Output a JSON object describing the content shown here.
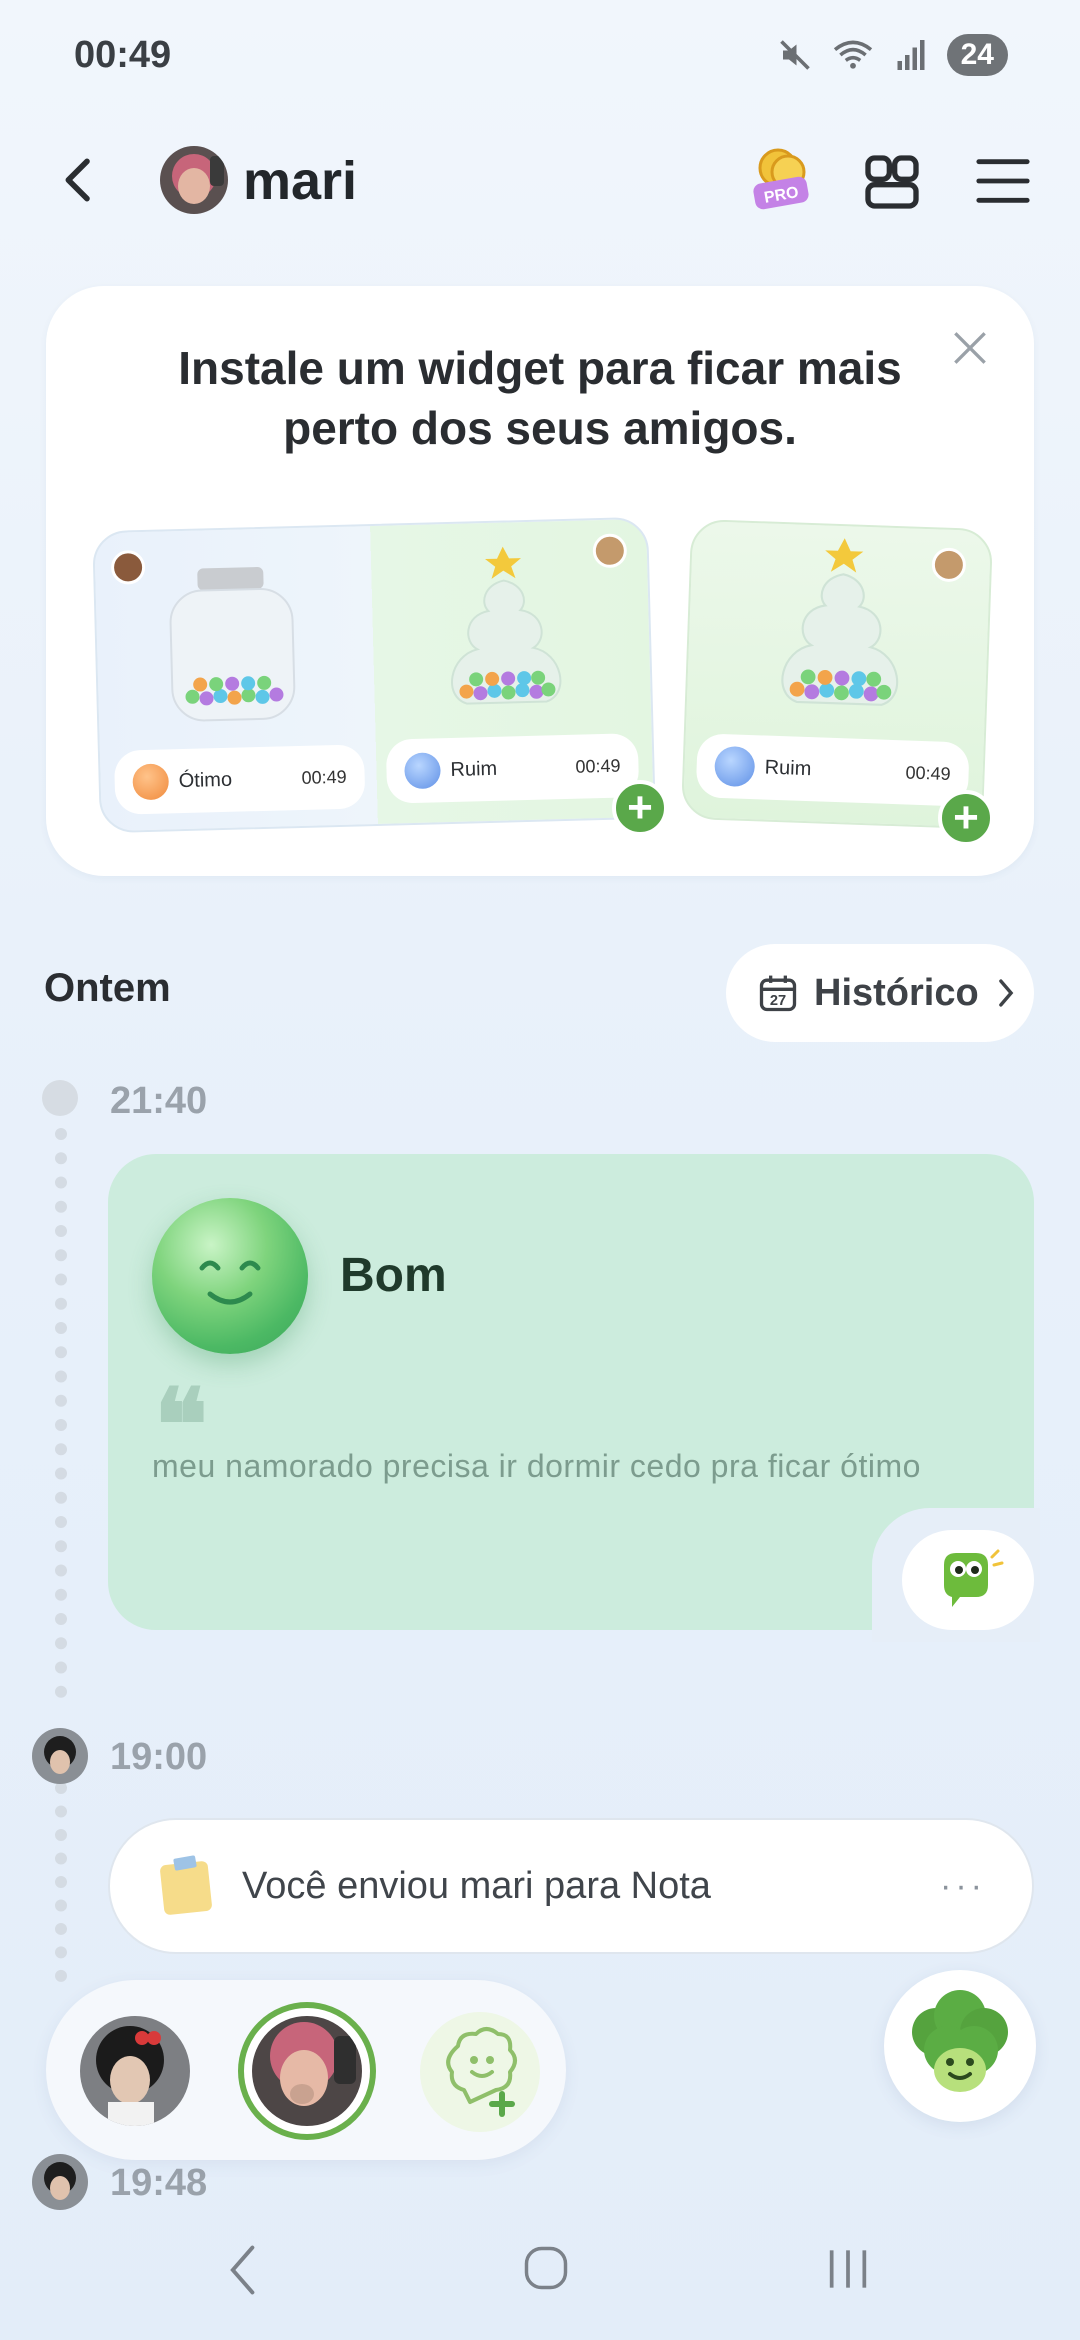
{
  "status_bar": {
    "time": "00:49",
    "battery": "24"
  },
  "header": {
    "title": "mari",
    "pro_label": "PRO"
  },
  "widget_promo": {
    "title": "Instale um widget para ficar mais perto dos seus amigos.",
    "previews": [
      {
        "mood": "Ótimo",
        "time": "00:49"
      },
      {
        "mood": "Ruim",
        "time": "00:49"
      },
      {
        "mood": "Ruim",
        "time": "00:49"
      }
    ]
  },
  "section": {
    "label": "Ontem",
    "history_label": "Histórico",
    "calendar_day": "27"
  },
  "timeline": {
    "entry1": {
      "time": "21:40",
      "mood": "Bom",
      "note": "meu namorado precisa ir dormir cedo pra ficar ótimo"
    },
    "entry2": {
      "time": "19:00",
      "text": "Você enviou mari para Nota",
      "more": "···"
    },
    "entry3": {
      "time": "19:48"
    }
  },
  "colors": {
    "accent_green": "#5aa84a",
    "mood_card": "#ccecdd",
    "background": "#e9f1fa"
  },
  "icons": [
    "back-icon",
    "widgets-icon",
    "menu-icon",
    "close-icon",
    "calendar-icon",
    "chevron-right-icon",
    "quote-icon",
    "reaction-icon",
    "note-icon",
    "add-friend-icon",
    "mascot-icon"
  ]
}
